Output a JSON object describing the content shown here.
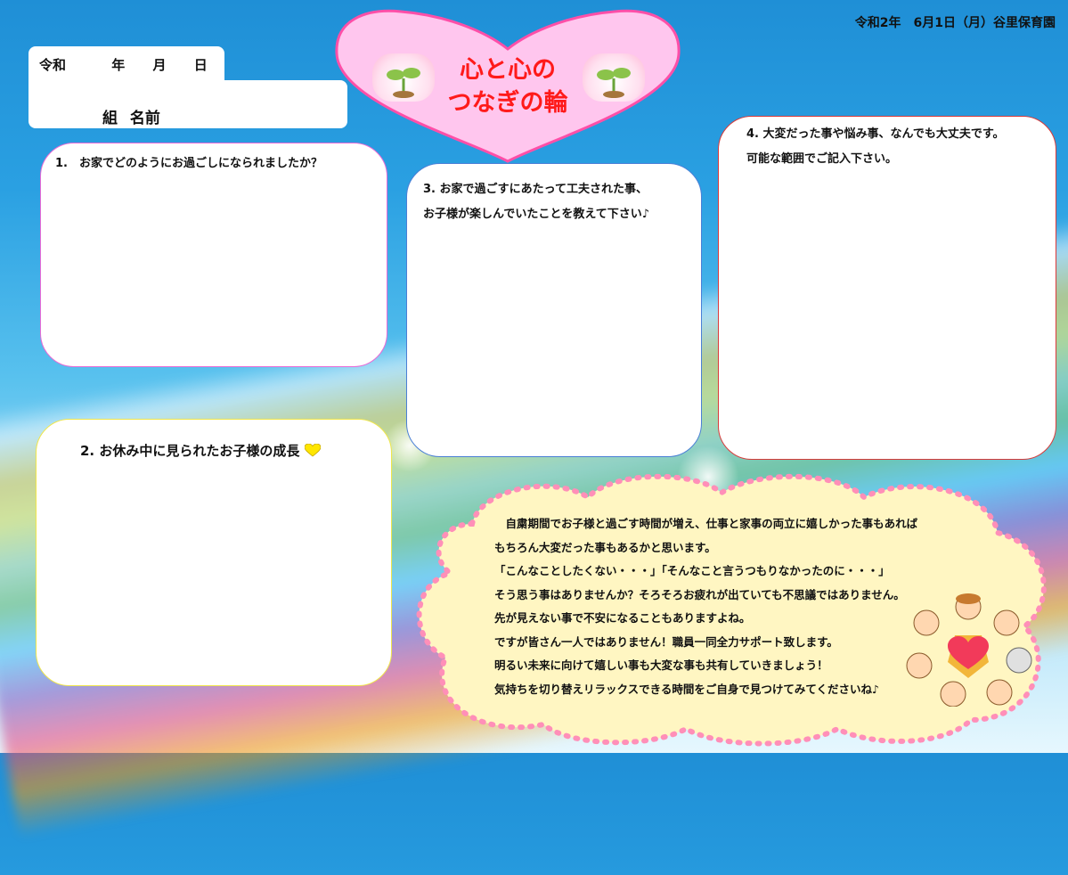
{
  "header": {
    "date": "令和2年　6月1日（月）谷里保育園"
  },
  "name_box": {
    "era": "令和",
    "year": "年",
    "month": "月",
    "day": "日",
    "class_label": "組",
    "name_label": "名前"
  },
  "title": {
    "line1": "心と心の",
    "line2": "つなぎの輪"
  },
  "q1": {
    "text": "1.　お家でどのようにお過ごしになられましたか？"
  },
  "q2": {
    "text": "2. お休み中に見られたお子様の成長"
  },
  "q3": {
    "line1": "3. お家で過ごすにあたって工夫された事、",
    "line2": "お子様が楽しんでいたことを教えて下さい♪"
  },
  "q4": {
    "line1": "4. 大変だった事や悩み事、なんでも大丈夫です。",
    "line2": "可能な範囲でご記入下さい。"
  },
  "message": {
    "lines": [
      "　自粛期間でお子様と過ごす時間が増え、仕事と家事の両立に嬉しかった事もあれば",
      "もちろん大変だった事もあるかと思います。",
      "「こんなことしたくない・・・」「そんなこと言うつもりなかったのに・・・」",
      "そう思う事はありませんか？そろそろお疲れが出ていても不思議ではありません。",
      "先が見えない事で不安になることもありますよね。",
      "ですが皆さん一人ではありません！職員一同全力サポート致します。",
      "明るい未来に向けて嬉しい事も大変な事も共有していきましょう！",
      "気持ちを切り替えリラックスできる時間をご自身で見つけてみてくださいね♪"
    ]
  },
  "colors": {
    "heart_fill": "#ffc6ee",
    "heart_stroke": "#ff4fa8",
    "title": "#ff1a1a",
    "cloud_fill": "#fff6c2",
    "cloud_dots": "#ff8fb8"
  }
}
